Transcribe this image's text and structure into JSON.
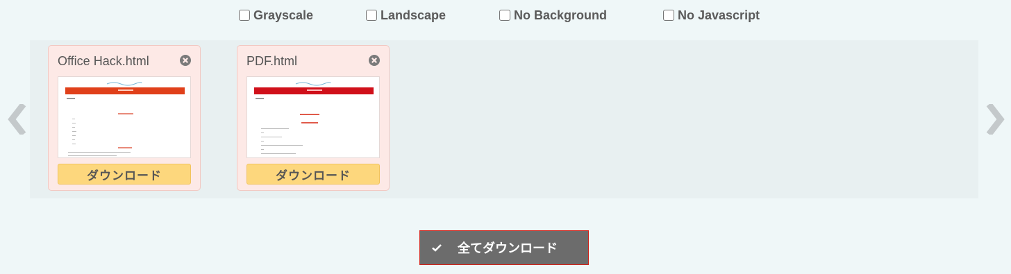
{
  "options": [
    {
      "label": "Grayscale",
      "checked": false
    },
    {
      "label": "Landscape",
      "checked": false
    },
    {
      "label": "No Background",
      "checked": false
    },
    {
      "label": "No Javascript",
      "checked": false
    }
  ],
  "nav": {
    "left_icon": "chevron-left-icon",
    "right_icon": "chevron-right-icon"
  },
  "files": [
    {
      "name": "Office Hack.html",
      "download_label": "ダウンロード",
      "close_icon": "close-circle-icon"
    },
    {
      "name": "PDF.html",
      "download_label": "ダウンロード",
      "close_icon": "close-circle-icon"
    }
  ],
  "download_all": {
    "label": "全てダウンロード",
    "icon": "checkmark-icon"
  },
  "colors": {
    "page_bg": "#eff7f8",
    "card_bg": "#fde9e6",
    "download_button": "#fdd77d",
    "download_all_bg": "#6c6c6c",
    "download_all_border": "#d0231a",
    "thumb_header_1": "#e0401a",
    "thumb_header_2": "#d0101a"
  }
}
